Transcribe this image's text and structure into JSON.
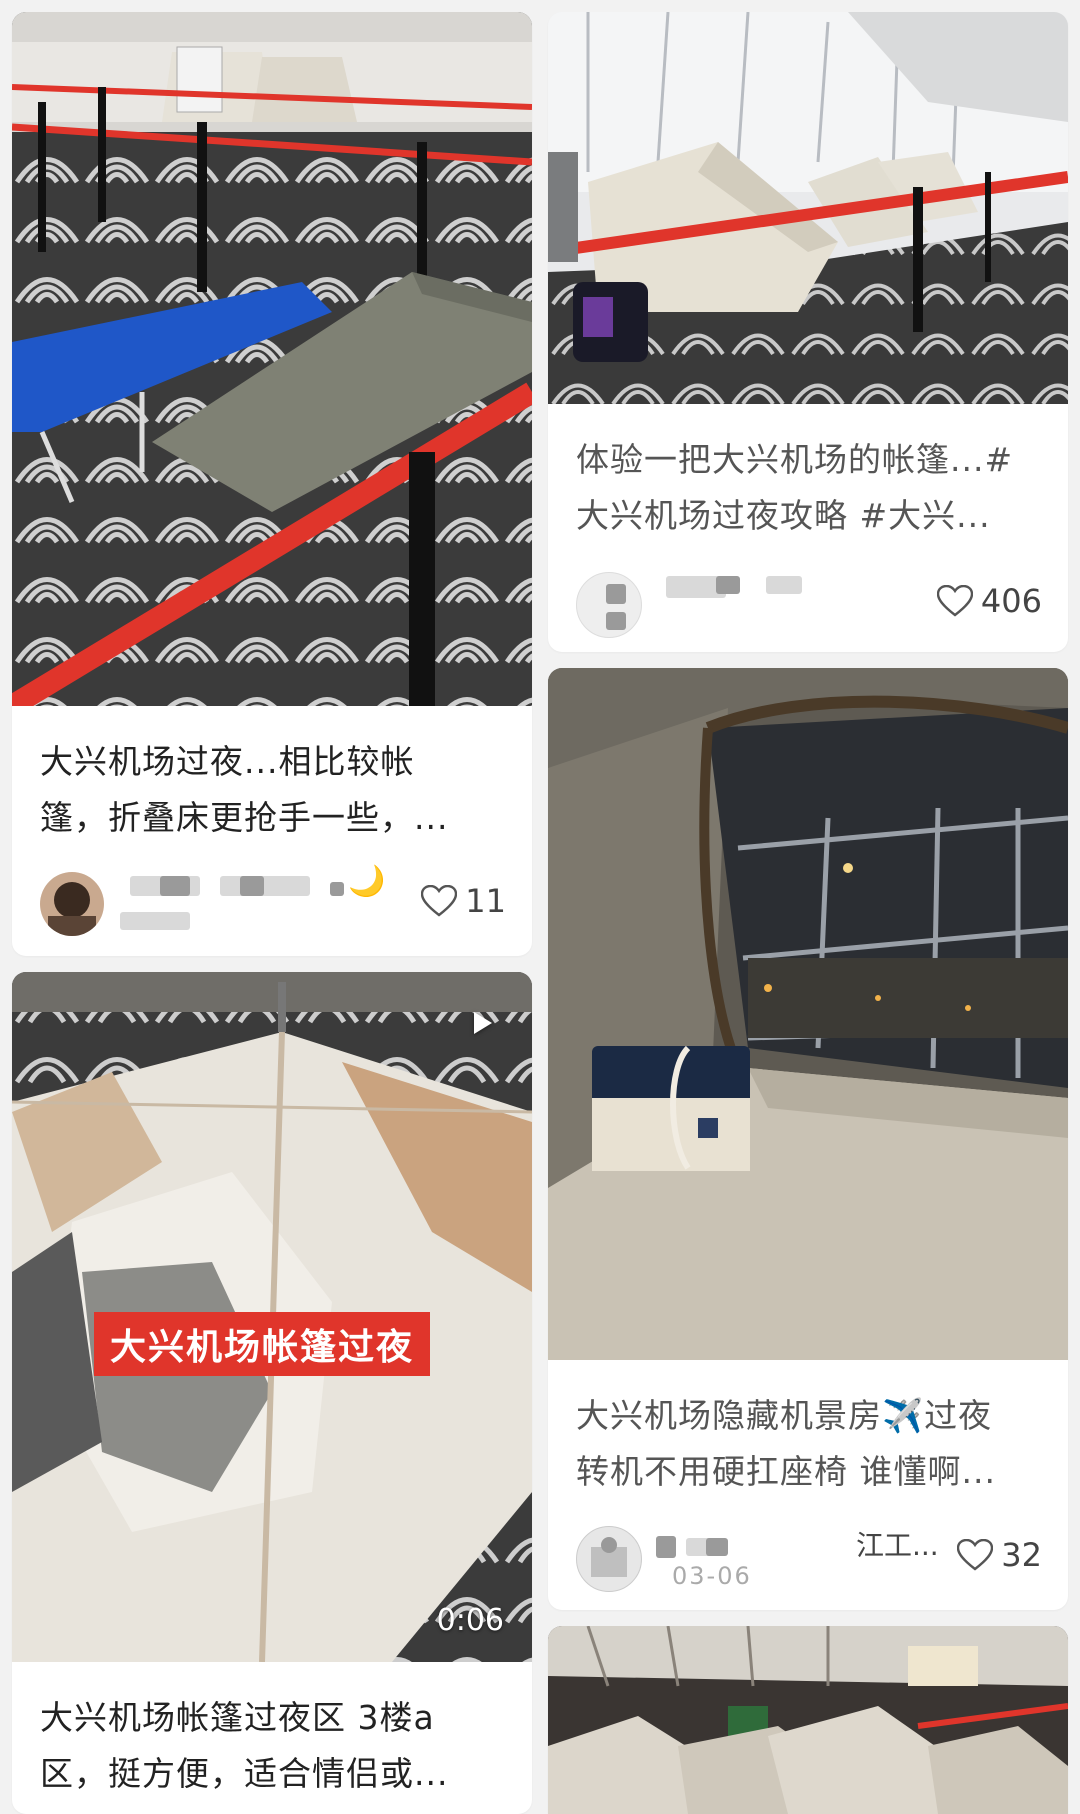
{
  "posts": [
    {
      "caption_line1": "大兴机场过夜...相比较帐",
      "caption_line2": "篷，折叠床更抢手一些，...",
      "author_suffix": "🌙",
      "likes": "11"
    },
    {
      "caption_line1": "体验一把大兴机场的帐篷...#",
      "caption_line2": "大兴机场过夜攻略 #大兴...",
      "likes": "406"
    },
    {
      "caption_line1": "大兴机场帐篷过夜区 3楼a",
      "caption_line2": "区，挺方便，适合情侣或...",
      "video_overlay": "大兴机场帐篷过夜",
      "duration": "0:06"
    },
    {
      "caption_line1": "大兴机场隐藏机景房✈️过夜",
      "caption_line2": "转机不用硬扛座椅 谁懂啊...",
      "author_partial": "江工...",
      "date_partial": "03-06",
      "likes": "32"
    },
    {}
  ],
  "icons": {
    "like": "heart-outline-icon",
    "play": "play-icon"
  },
  "colors": {
    "background": "#f2f2f2",
    "card": "#ffffff",
    "barrier_tape": "#e0352b",
    "cot_blue": "#1f57c8",
    "cot_olive": "#7f8174"
  }
}
